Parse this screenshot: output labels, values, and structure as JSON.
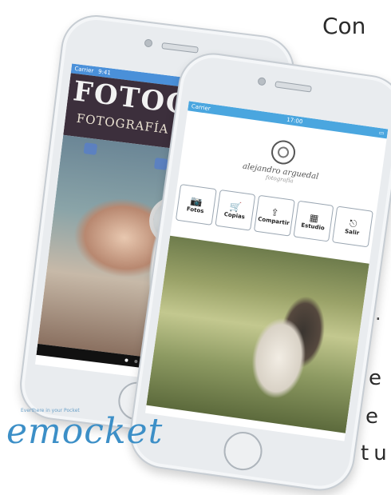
{
  "side_text": {
    "line1": "Con",
    "dot": "·",
    "line2": "e",
    "line3": "e",
    "line4": "tu"
  },
  "phone1": {
    "status_left": "Carrier",
    "status_center": "9:41",
    "header_logo": "FOTOCH",
    "header_sub": "FOTOGRAFÍA & V",
    "icons": [
      "camera-icon",
      "image-icon"
    ],
    "carousel_dots": 4,
    "active_dot": 1
  },
  "phone2": {
    "status_left": "Carrier",
    "status_center": "17:00",
    "logo_name": "alejandro arguedal",
    "logo_tag": "fotografía",
    "menu": [
      {
        "icon": "camera-icon",
        "glyph": "📷",
        "label": "Fotos"
      },
      {
        "icon": "cart-icon",
        "glyph": "🛒",
        "label": "Copias"
      },
      {
        "icon": "share-icon",
        "glyph": "⇪",
        "label": "Compartir"
      },
      {
        "icon": "studio-icon",
        "glyph": "▦",
        "label": "Estudio"
      },
      {
        "icon": "exit-icon",
        "glyph": "⎋",
        "label": "Salir"
      }
    ]
  },
  "brand": {
    "tagline": "Everthere in your Pocket",
    "name": "emocket",
    "color": "#3c8fc7"
  }
}
